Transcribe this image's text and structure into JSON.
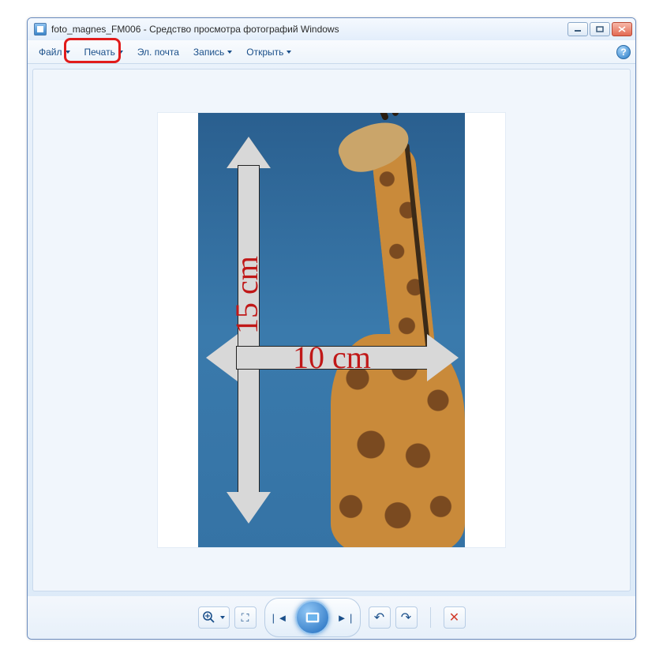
{
  "titlebar": {
    "title": "foto_magnes_FM006 - Средство просмотра фотографий Windows"
  },
  "menu": {
    "file": "Файл",
    "print": "Печать",
    "email": "Эл. почта",
    "burn": "Запись",
    "open": "Открыть"
  },
  "help": {
    "symbol": "?"
  },
  "image": {
    "width_label": "10 cm",
    "height_label": "15 cm"
  },
  "toolbar": {
    "zoom_glyph": "🔍⁺",
    "fit_glyph": "⛶",
    "prev_glyph": "| ◄",
    "next_glyph": "► |",
    "rotate_ccw": "↶",
    "rotate_cw": "↷",
    "delete_glyph": "✕"
  }
}
